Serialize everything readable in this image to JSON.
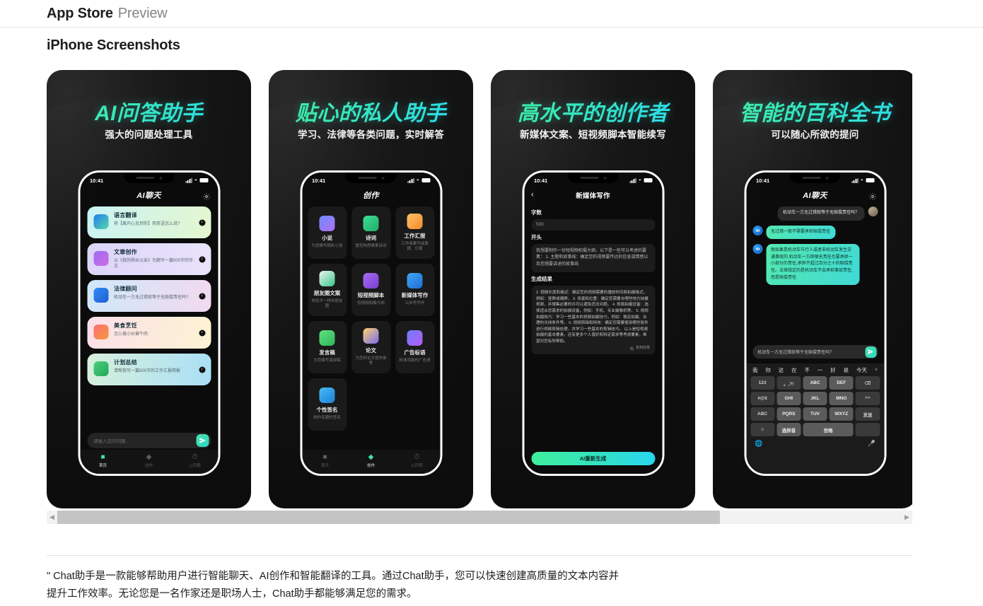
{
  "header": {
    "brand": "App Store",
    "sub": "Preview"
  },
  "section": {
    "title": "iPhone Screenshots"
  },
  "scrollbar": {
    "left_arrow": "◀",
    "right_arrow": "▶"
  },
  "footer": {
    "description": "\" Chat助手是一款能够帮助用户进行智能聊天、AI创作和智能翻译的工具。通过Chat助手，您可以快速创建高质量的文本内容并提升工作效率。无论您是一名作家还是职场人士，Chat助手都能够满足您的需求。"
  },
  "colors": {
    "headline_gradient_start": "#3ff09a",
    "headline_gradient_end": "#2ad8f0",
    "accent_send": "#3fd9c0",
    "card_bg": "#1a1a1a"
  },
  "shots": [
    {
      "headline": "AI问答助手",
      "subhead": "强大的问题处理工具",
      "status_time": "10:41",
      "nav_title": "AI聊天",
      "cards": [
        {
          "title": "语言翻译",
          "desc": "将【离开心见到你】用英语怎么说?",
          "icon": "translate-icon"
        },
        {
          "title": "文章创作",
          "desc": "以《我的杨长父亲》为题写一篇500字的作文",
          "icon": "pencil-icon"
        },
        {
          "title": "法律顾问",
          "desc": "机动车一方无过错就等于无赔偿责任吗?",
          "icon": "law-icon"
        },
        {
          "title": "美食烹饪",
          "desc": "怎么做小炒黄牛肉",
          "icon": "food-icon"
        },
        {
          "title": "计划总结",
          "desc": "请帮我写一篇500字的工作汇报简报",
          "icon": "checklist-icon"
        }
      ],
      "composer_placeholder": "请输入您的问题...",
      "tabs": [
        {
          "label": "首页",
          "icon": "home-icon",
          "active": true
        },
        {
          "label": "创作",
          "icon": "diamond-icon",
          "active": false
        },
        {
          "label": "心历程",
          "icon": "history-icon",
          "active": false
        }
      ]
    },
    {
      "headline": "贴心的私人助手",
      "subhead": "学习、法律等各类问题，实时解答",
      "status_time": "10:41",
      "nav_title": "创作",
      "grid": [
        {
          "title": "小说",
          "desc": "为您模写精彩小说",
          "icon": "book-icon"
        },
        {
          "title": "诗词",
          "desc": "替您构思模柔诗词",
          "icon": "poem-icon"
        },
        {
          "title": "工作汇报",
          "desc": "工作成果写成周报、日报",
          "icon": "report-icon"
        },
        {
          "title": "朋友圈文案",
          "desc": "体验不一样的朋友圈",
          "icon": "moments-icon"
        },
        {
          "title": "短视频脚本",
          "desc": "短视频拍摄大纲",
          "icon": "video-icon"
        },
        {
          "title": "新媒体写作",
          "desc": "公众号写作",
          "icon": "media-icon"
        },
        {
          "title": "发言稿",
          "desc": "为您编写演讲稿",
          "icon": "speech-icon"
        },
        {
          "title": "论文",
          "desc": "为您的论文提供参考",
          "icon": "paper-icon"
        },
        {
          "title": "广告标语",
          "desc": "校准同款的广告语",
          "icon": "ad-icon"
        },
        {
          "title": "个性签名",
          "desc": "制作有趣的签名",
          "icon": "signature-icon"
        }
      ],
      "tabs": [
        {
          "label": "首页",
          "icon": "home-icon",
          "active": false
        },
        {
          "label": "创作",
          "icon": "diamond-icon",
          "active": true
        },
        {
          "label": "心历程",
          "icon": "history-icon",
          "active": false
        }
      ]
    },
    {
      "headline": "高水平的创作者",
      "subhead": "新媒体文案、短视频脚本智能续写",
      "status_time": "10:41",
      "nav_title": "新媒体写作",
      "back_icon": "chevron-left-icon",
      "form": {
        "wordcount_label": "字数",
        "wordcount_value": "500",
        "opening_label": "开头",
        "opening_text": "我想要制作一份短视频拍摄大纲，以下是一些可以考虑的要素：\n1. 主题和故事线：确定您的视频要传达的信息或情感以及您想要讲述的故事线",
        "result_label": "生成结果",
        "result_text": "2. 视频长度和格式：确定您的视频需要的播放时间和拍摄格式，例如：竖屏或横屏。\n3. 场景和位置：确定您需要去哪些地方拍摄视频，并搜集必要的许可以避免违法问题。\n4. 视频拍摄设备：选择适合您需求的拍摄设备，例如：手机、专业摄像机等。\n5. 视频拍摄技巧：学习一些基本的视频拍摄技巧，例如：稳定拍摄、合理的光线条件等。\n6. 视频剪辑和特效：确定您需要使用哪些软件进行视频剪辑处理，并学习一些基本的剪辑技巧。\n以上是短视频拍摄的基本要素，还有更多个人喜好和特定需求等考虑要素，希望对您有所帮助。",
        "copy_label": "复制结果",
        "copy_icon": "copy-icon",
        "regenerate_label": "AI重新生成"
      }
    },
    {
      "headline": "智能的百科全书",
      "subhead": "可以随心所欲的提问",
      "status_time": "10:41",
      "nav_title": "AI聊天",
      "chat": [
        {
          "from": "user",
          "text": "机动车一方无过错就等于无赔偿责任吗？"
        },
        {
          "from": "ai",
          "text": "无过错一般不需要承担赔偿责任"
        },
        {
          "from": "ai",
          "text": "假如果是机动车与行人或者非机动车发生交通事故的,机动车一方即便无责任也要承担一小部分的责任,承担不超过百分之十的赔偿责任。法律规定的是机动车不会承担事故责任,而是赔偿责任"
        }
      ],
      "chat_input_value": "机动车一方无过错就等于无赔偿责任吗？",
      "keyboard": {
        "suggestions": [
          "我",
          "你",
          "这",
          "在",
          "不",
          "一",
          "好",
          "是",
          "今天"
        ],
        "expand_icon": "chevron-down-icon",
        "rows": [
          [
            "123",
            "。,?!",
            "ABC",
            "DEF",
            "⌫"
          ],
          [
            "#@¥",
            "GHI",
            "JKL",
            "MNO",
            "^^"
          ],
          [
            "ABC",
            "PQRS",
            "TUV",
            "WXYZ",
            "发送"
          ],
          [
            "☺",
            "选拼音",
            "空格"
          ]
        ],
        "globe_icon": "globe-icon",
        "mic_icon": "microphone-icon"
      }
    }
  ]
}
